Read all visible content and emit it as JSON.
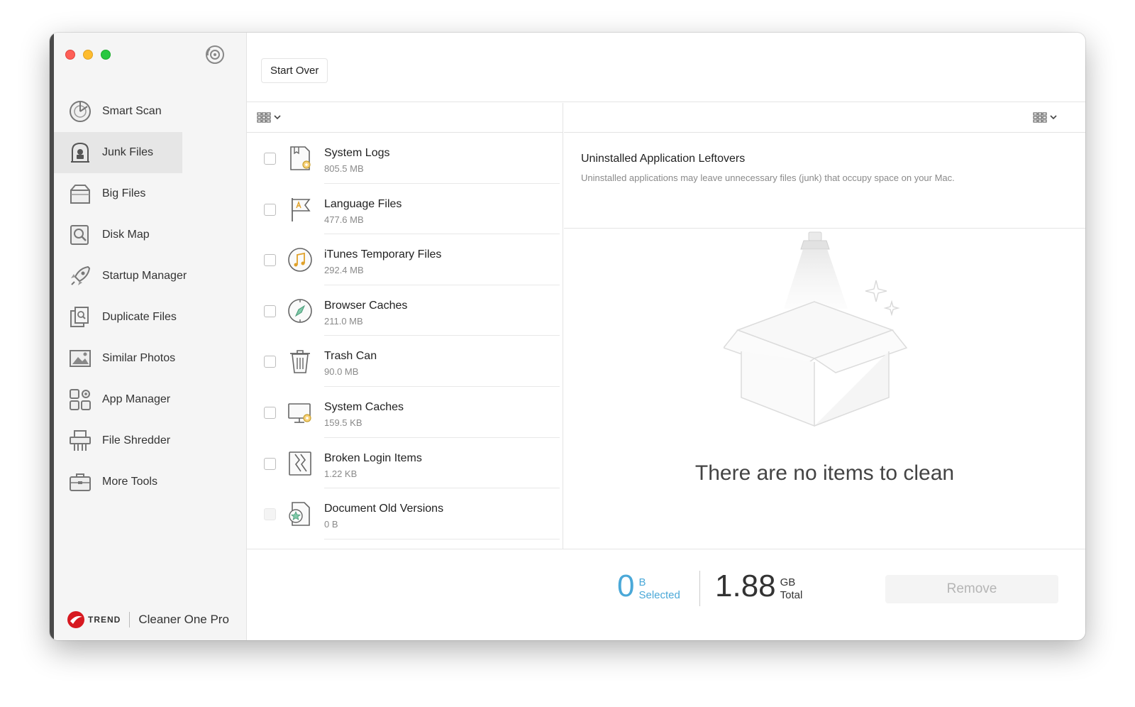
{
  "sidebar": {
    "items": [
      {
        "label": "Smart Scan",
        "icon": "radar-icon"
      },
      {
        "label": "Junk Files",
        "icon": "vacuum-icon",
        "active": true
      },
      {
        "label": "Big Files",
        "icon": "box-icon"
      },
      {
        "label": "Disk Map",
        "icon": "magnifier-disk-icon"
      },
      {
        "label": "Startup Manager",
        "icon": "rocket-icon"
      },
      {
        "label": "Duplicate Files",
        "icon": "duplicate-icon"
      },
      {
        "label": "Similar Photos",
        "icon": "photo-icon"
      },
      {
        "label": "App Manager",
        "icon": "apps-gear-icon"
      },
      {
        "label": "File Shredder",
        "icon": "shredder-icon"
      },
      {
        "label": "More Tools",
        "icon": "toolbox-icon"
      }
    ],
    "brand": {
      "logo_text": "TREND",
      "product": "Cleaner One Pro"
    }
  },
  "toolbar": {
    "start_over_label": "Start Over"
  },
  "junk_list": [
    {
      "name": "System Logs",
      "size": "805.5 MB",
      "icon": "log-file-icon"
    },
    {
      "name": "Language Files",
      "size": "477.6 MB",
      "icon": "flag-icon"
    },
    {
      "name": "iTunes Temporary Files",
      "size": "292.4 MB",
      "icon": "music-note-icon"
    },
    {
      "name": "Browser Caches",
      "size": "211.0 MB",
      "icon": "compass-icon"
    },
    {
      "name": "Trash Can",
      "size": "90.0 MB",
      "icon": "trash-icon"
    },
    {
      "name": "System Caches",
      "size": "159.5 KB",
      "icon": "monitor-gear-icon"
    },
    {
      "name": "Broken Login Items",
      "size": "1.22 KB",
      "icon": "broken-link-icon"
    },
    {
      "name": "Document Old Versions",
      "size": "0 B",
      "icon": "document-star-icon",
      "disabled": true
    }
  ],
  "detail": {
    "title": "Uninstalled Application Leftovers",
    "description": "Uninstalled applications may leave unnecessary files (junk) that occupy space on your Mac.",
    "empty_message": "There are no items to clean"
  },
  "footer": {
    "selected_value": "0",
    "selected_unit": "B",
    "selected_label": "Selected",
    "total_value": "1.88",
    "total_unit": "GB",
    "total_label": "Total",
    "remove_label": "Remove"
  },
  "colors": {
    "accent": "#4aa8d8",
    "close": "#fe5f57",
    "minimize": "#febc2e",
    "zoom": "#28c840"
  }
}
